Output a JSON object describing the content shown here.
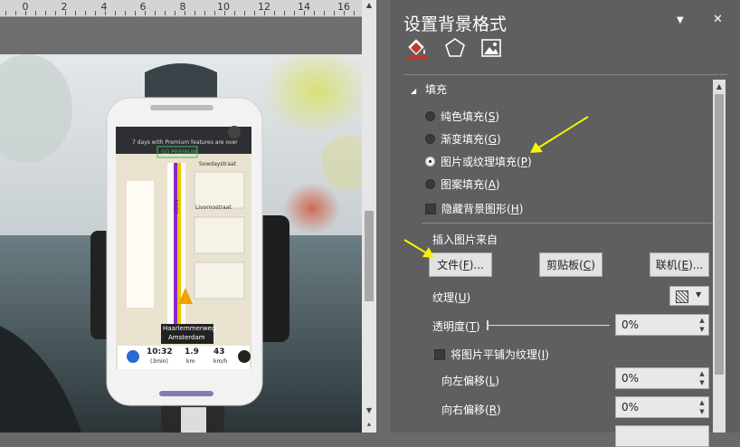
{
  "ruler": {
    "labels": [
      "0",
      "2",
      "4",
      "6",
      "8",
      "10",
      "12",
      "14",
      "16"
    ]
  },
  "pane": {
    "title": "设置背景格式",
    "dropdown_glyph": "▼",
    "close_glyph": "✕",
    "tabs": [
      {
        "name": "fill-tab",
        "icon": "paint-bucket-icon"
      },
      {
        "name": "effects-tab",
        "icon": "pentagon-icon"
      },
      {
        "name": "picture-tab",
        "icon": "picture-icon"
      }
    ],
    "fill": {
      "section": "填充",
      "expand_glyph": "◢",
      "options": [
        {
          "label": "纯色填充(",
          "key": "S",
          "suffix": ")",
          "selected": false
        },
        {
          "label": "渐变填充(",
          "key": "G",
          "suffix": ")",
          "selected": false
        },
        {
          "label": "图片或纹理填充(",
          "key": "P",
          "suffix": ")",
          "selected": true
        },
        {
          "label": "图案填充(",
          "key": "A",
          "suffix": ")",
          "selected": false
        }
      ],
      "hide_bg": {
        "label": "隐藏背景图形(",
        "key": "H",
        "suffix": ")"
      },
      "insert_from": "插入图片来自",
      "buttons": {
        "file": {
          "label": "文件(",
          "key": "F",
          "suffix": ")..."
        },
        "clipboard": {
          "label": "剪贴板(",
          "key": "C",
          "suffix": ")"
        },
        "online": {
          "label": "联机(",
          "key": "E",
          "suffix": ")..."
        }
      },
      "texture": {
        "label": "纹理(",
        "key": "U",
        "suffix": ")"
      },
      "transparency": {
        "label": "透明度(",
        "key": "T",
        "suffix": ")",
        "value": "0%"
      },
      "tile": {
        "label": "将图片平铺为纹理(",
        "key": "I",
        "suffix": ")"
      },
      "offset_left": {
        "label": "向左偏移(",
        "key": "L",
        "suffix": ")",
        "value": "0%"
      },
      "offset_right": {
        "label": "向右偏移(",
        "key": "R",
        "suffix": ")",
        "value": "0%"
      }
    }
  },
  "phone": {
    "promo": "7 days with Premium features are over",
    "premium": "GO PREMIUM",
    "street1": "Sowdaystraat",
    "street2": "Livornostraat",
    "road": "N102",
    "dest_line1": "Haarlemmerweg",
    "dest_line2": "Amsterdam",
    "time_val": "10:32",
    "time_sub": "(3min)",
    "dist_val": "1.9",
    "dist_sub": "km",
    "speed_val": "43",
    "speed_sub": "km/h"
  },
  "colors": {
    "pane_bg": "#5f5f5f",
    "annotation_arrow": "#f5f500",
    "bucket_red": "#c0392b"
  }
}
